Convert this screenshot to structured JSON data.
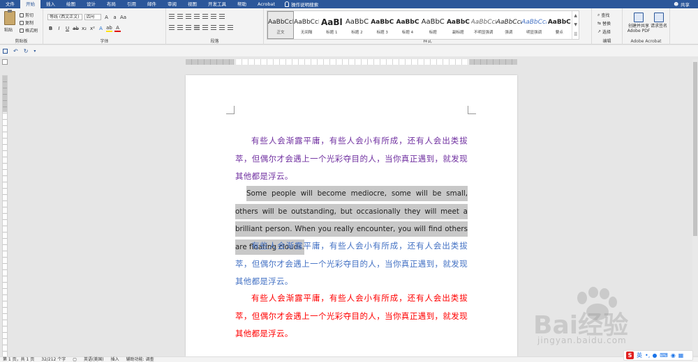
{
  "menu": {
    "tabs": [
      "文件",
      "开始",
      "插入",
      "绘图",
      "设计",
      "布局",
      "引用",
      "邮件",
      "审阅",
      "视图",
      "开发工具",
      "帮助",
      "Acrobat"
    ],
    "active_tab": "开始",
    "search": "操作说明搜索",
    "share": "共享"
  },
  "ribbon": {
    "clipboard": {
      "paste": "粘贴",
      "cut": "剪切",
      "copy": "复制",
      "format_painter": "格式刷",
      "label": "剪贴板"
    },
    "font": {
      "font_name": "等线 (西文正文)",
      "font_size": "四号",
      "label": "字体"
    },
    "paragraph": {
      "label": "段落"
    },
    "styles": {
      "label": "样式",
      "items": [
        {
          "preview": "AaBbCcI",
          "name": "正文"
        },
        {
          "preview": "AaBbCcI",
          "name": "无间隔"
        },
        {
          "preview": "AaBl",
          "name": "标题 1"
        },
        {
          "preview": "AaBbC",
          "name": "标题 2"
        },
        {
          "preview": "AaBbC",
          "name": "标题 3"
        },
        {
          "preview": "AaBbC",
          "name": "标题 4"
        },
        {
          "preview": "AaBbC",
          "name": "标题"
        },
        {
          "preview": "AaBbC",
          "name": "副标题"
        },
        {
          "preview": "AaBbCcI",
          "name": "不明显强调"
        },
        {
          "preview": "AaBbCcI",
          "name": "强调"
        },
        {
          "preview": "AaBbCcI",
          "name": "明显强调"
        },
        {
          "preview": "AaBbC",
          "name": "要点"
        }
      ]
    },
    "editing": {
      "find": "查找",
      "replace": "替换",
      "select": "选择",
      "label": "编辑"
    },
    "acrobat": {
      "create": "创建并共享 Adobe PDF",
      "request": "请求签名",
      "label": "Adobe Acrobat"
    }
  },
  "document": {
    "para1": "有些人会渐露平庸，有些人会小有所成，还有人会出类拔萃，但偶尔才会遇上一个光彩夺目的人，当你真正遇到，就发现其他都是浮云。",
    "para2": "Some people will become mediocre, some will be small, others will be outstanding, but occasionally they will meet a brilliant person. When you really encounter, you will find others are floating clouds.",
    "para3": "有些人会渐露平庸，有些人会小有所成，还有人会出类拔萃，但偶尔才会遇上一个光彩夺目的人，当你真正遇到，就发现其他都是浮云。",
    "para4": "有些人会渐露平庸，有些人会小有所成，还有人会出类拔萃，但偶尔才会遇上一个光彩夺目的人，当你真正遇到，就发现其他都是浮云。"
  },
  "status": {
    "page": "第 1 页，共 1 页",
    "words": "32/212 个字",
    "language": "英语(美国)",
    "mode": "插入",
    "accessibility": "辅助功能: 调查"
  },
  "watermark": {
    "brand": "Bai经验",
    "url": "jingyan.baidu.com"
  },
  "ime": {
    "lang": "英"
  },
  "colors": {
    "purple": "#7030a0",
    "blue": "#4472c4",
    "red": "#ff0000",
    "accent": "#2b579a"
  }
}
